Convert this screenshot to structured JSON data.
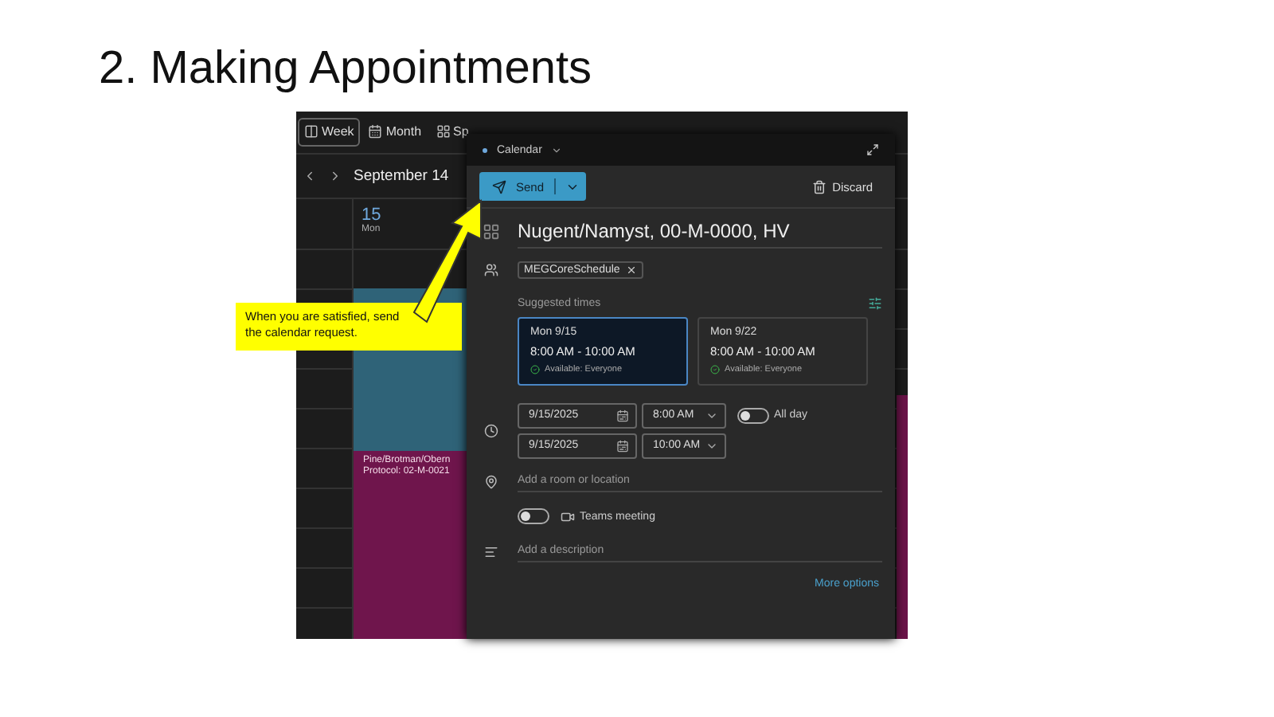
{
  "slide": {
    "title": "2. Making Appointments"
  },
  "calendar": {
    "views": [
      {
        "label": "Week",
        "selected": true
      },
      {
        "label": "Month",
        "selected": false
      },
      {
        "label": "Sp",
        "selected": false
      }
    ],
    "range_title": "September 14",
    "day": {
      "date": "15",
      "weekday": "Mon"
    },
    "events": [
      {
        "kind": "plain",
        "color": "#2d5e72"
      },
      {
        "kind": "titled",
        "color": "#6a1448",
        "lines": [
          "Pine/Brotman/Obern",
          "Protocol: 02-M-0021"
        ]
      }
    ]
  },
  "compose": {
    "calendar_name": "Calendar",
    "send_label": "Send",
    "discard_label": "Discard",
    "title": "Nugent/Namyst, 00-M-0000, HV",
    "attendees": [
      "MEGCoreSchedule"
    ],
    "suggested_label": "Suggested times",
    "suggestions": [
      {
        "day": "Mon 9/15",
        "time": "8:00 AM - 10:00 AM",
        "availability": "Available: Everyone",
        "selected": true
      },
      {
        "day": "Mon 9/22",
        "time": "8:00 AM - 10:00 AM",
        "availability": "Available: Everyone",
        "selected": false
      }
    ],
    "start": {
      "date": "9/15/2025",
      "time": "8:00 AM"
    },
    "end": {
      "date": "9/15/2025",
      "time": "10:00 AM"
    },
    "all_day": {
      "label": "All day",
      "on": false
    },
    "location_placeholder": "Add a room or location",
    "teams": {
      "label": "Teams meeting",
      "on": false
    },
    "description_placeholder": "Add a description",
    "more_options": "More options"
  },
  "callout": {
    "text": "When you are satisfied, send the calendar request."
  }
}
